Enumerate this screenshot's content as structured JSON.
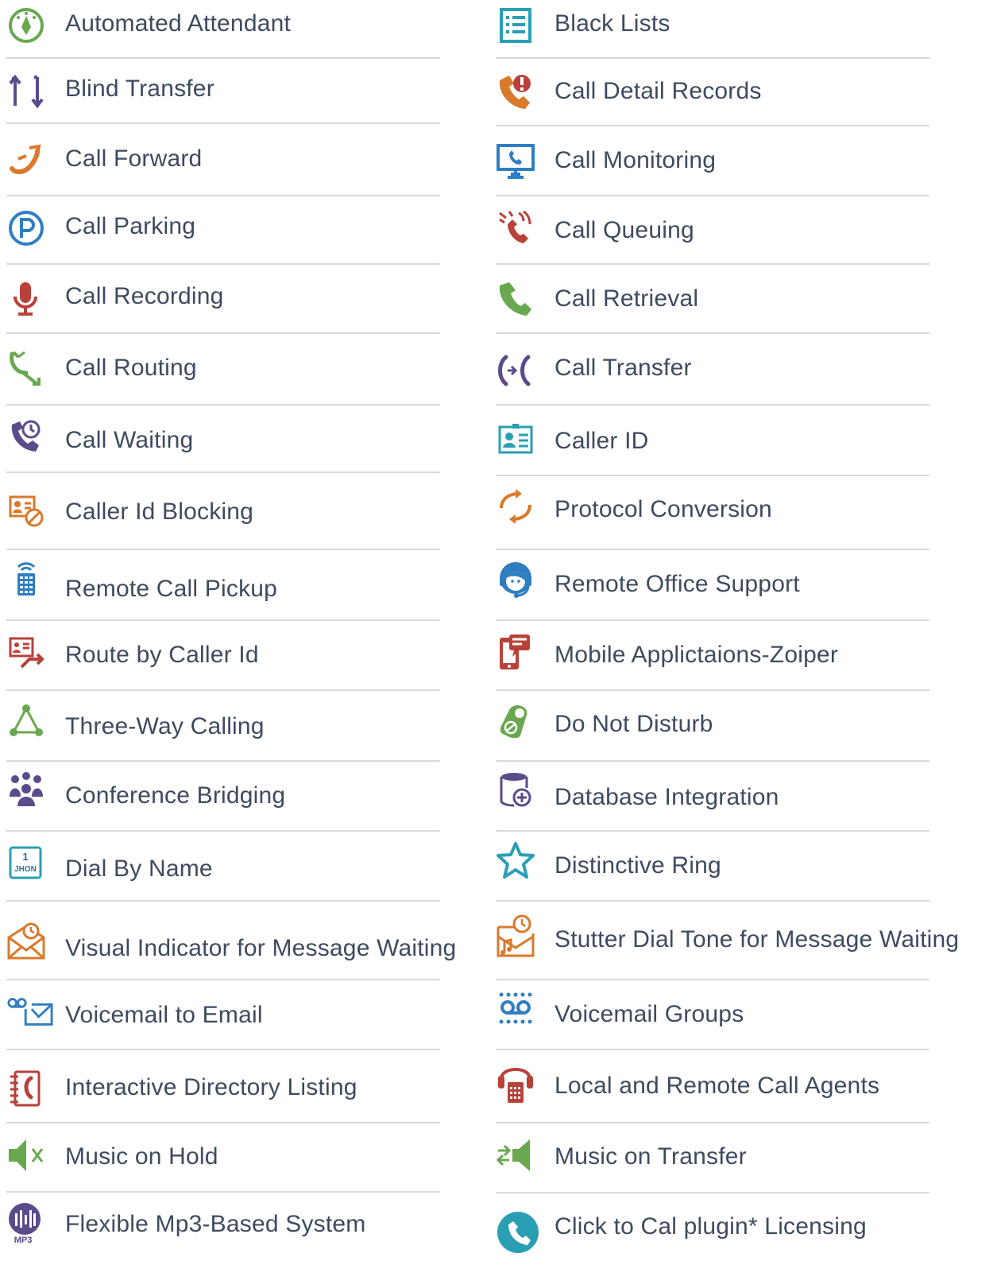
{
  "colors": {
    "text": "#3e4a5f",
    "divider": "#d7d9dd",
    "green": "#6aa84f",
    "purple": "#5b4b8a",
    "orange": "#d9792b",
    "blue": "#2f7ec1",
    "red": "#b8413a",
    "teal": "#2a9fb4"
  },
  "left_column": [
    {
      "label": "Automated Attendant",
      "icon": "compass-icon"
    },
    {
      "label": "Blind Transfer",
      "icon": "transfer-arrows-icon"
    },
    {
      "label": "Call Forward",
      "icon": "call-forward-icon"
    },
    {
      "label": "Call Parking",
      "icon": "parking-icon"
    },
    {
      "label": "Call Recording",
      "icon": "microphone-icon"
    },
    {
      "label": "Call Routing",
      "icon": "call-routing-icon"
    },
    {
      "label": "Call Waiting",
      "icon": "call-waiting-icon"
    },
    {
      "label": "Caller Id Blocking",
      "icon": "id-blocking-icon"
    },
    {
      "label": "Remote Call Pickup",
      "icon": "remote-control-icon"
    },
    {
      "label": "Route by Caller Id",
      "icon": "route-by-id-icon"
    },
    {
      "label": "Three-Way Calling",
      "icon": "triangle-network-icon"
    },
    {
      "label": "Conference Bridging",
      "icon": "people-group-icon"
    },
    {
      "label": "Dial By Name",
      "icon": "dial-by-name-icon",
      "icon_text_top": "1",
      "icon_text_bottom": "JHON"
    },
    {
      "label": "Visual Indicator for Message Waiting",
      "icon": "envelope-clock-icon"
    },
    {
      "label": "Voicemail to Email",
      "icon": "voicemail-email-icon"
    },
    {
      "label": "Interactive Directory Listing",
      "icon": "directory-book-icon"
    },
    {
      "label": "Music on Hold",
      "icon": "speaker-mute-icon"
    },
    {
      "label": "Flexible Mp3-Based System",
      "icon": "mp3-icon",
      "icon_text": "MP3"
    }
  ],
  "right_column": [
    {
      "label": "Black Lists",
      "icon": "list-icon"
    },
    {
      "label": "Call Detail Records",
      "icon": "phone-alert-icon"
    },
    {
      "label": "Call Monitoring",
      "icon": "monitor-phone-icon"
    },
    {
      "label": "Call Queuing",
      "icon": "phone-ringing-icon"
    },
    {
      "label": "Call Retrieval",
      "icon": "phone-handset-icon"
    },
    {
      "label": "Call Transfer",
      "icon": "call-transfer-icon"
    },
    {
      "label": "Caller ID",
      "icon": "id-card-icon"
    },
    {
      "label": "Protocol Conversion",
      "icon": "swap-arrows-icon"
    },
    {
      "label": "Remote Office Support",
      "icon": "headset-agent-icon"
    },
    {
      "label": "Mobile Applictaions-Zoiper",
      "icon": "mobile-chat-icon"
    },
    {
      "label": "Do Not Disturb",
      "icon": "door-hanger-icon"
    },
    {
      "label": "Database Integration",
      "icon": "database-add-icon"
    },
    {
      "label": "Distinctive Ring",
      "icon": "star-icon"
    },
    {
      "label": "Stutter Dial Tone for Message Waiting",
      "icon": "music-clock-icon"
    },
    {
      "label": "Voicemail Groups",
      "icon": "voicemail-group-icon"
    },
    {
      "label": "Local and Remote Call Agents",
      "icon": "headset-keypad-icon"
    },
    {
      "label": "Music on Transfer",
      "icon": "speaker-transfer-icon"
    },
    {
      "label": "Click to Cal  plugin* Licensing",
      "icon": "click-to-call-icon"
    }
  ]
}
